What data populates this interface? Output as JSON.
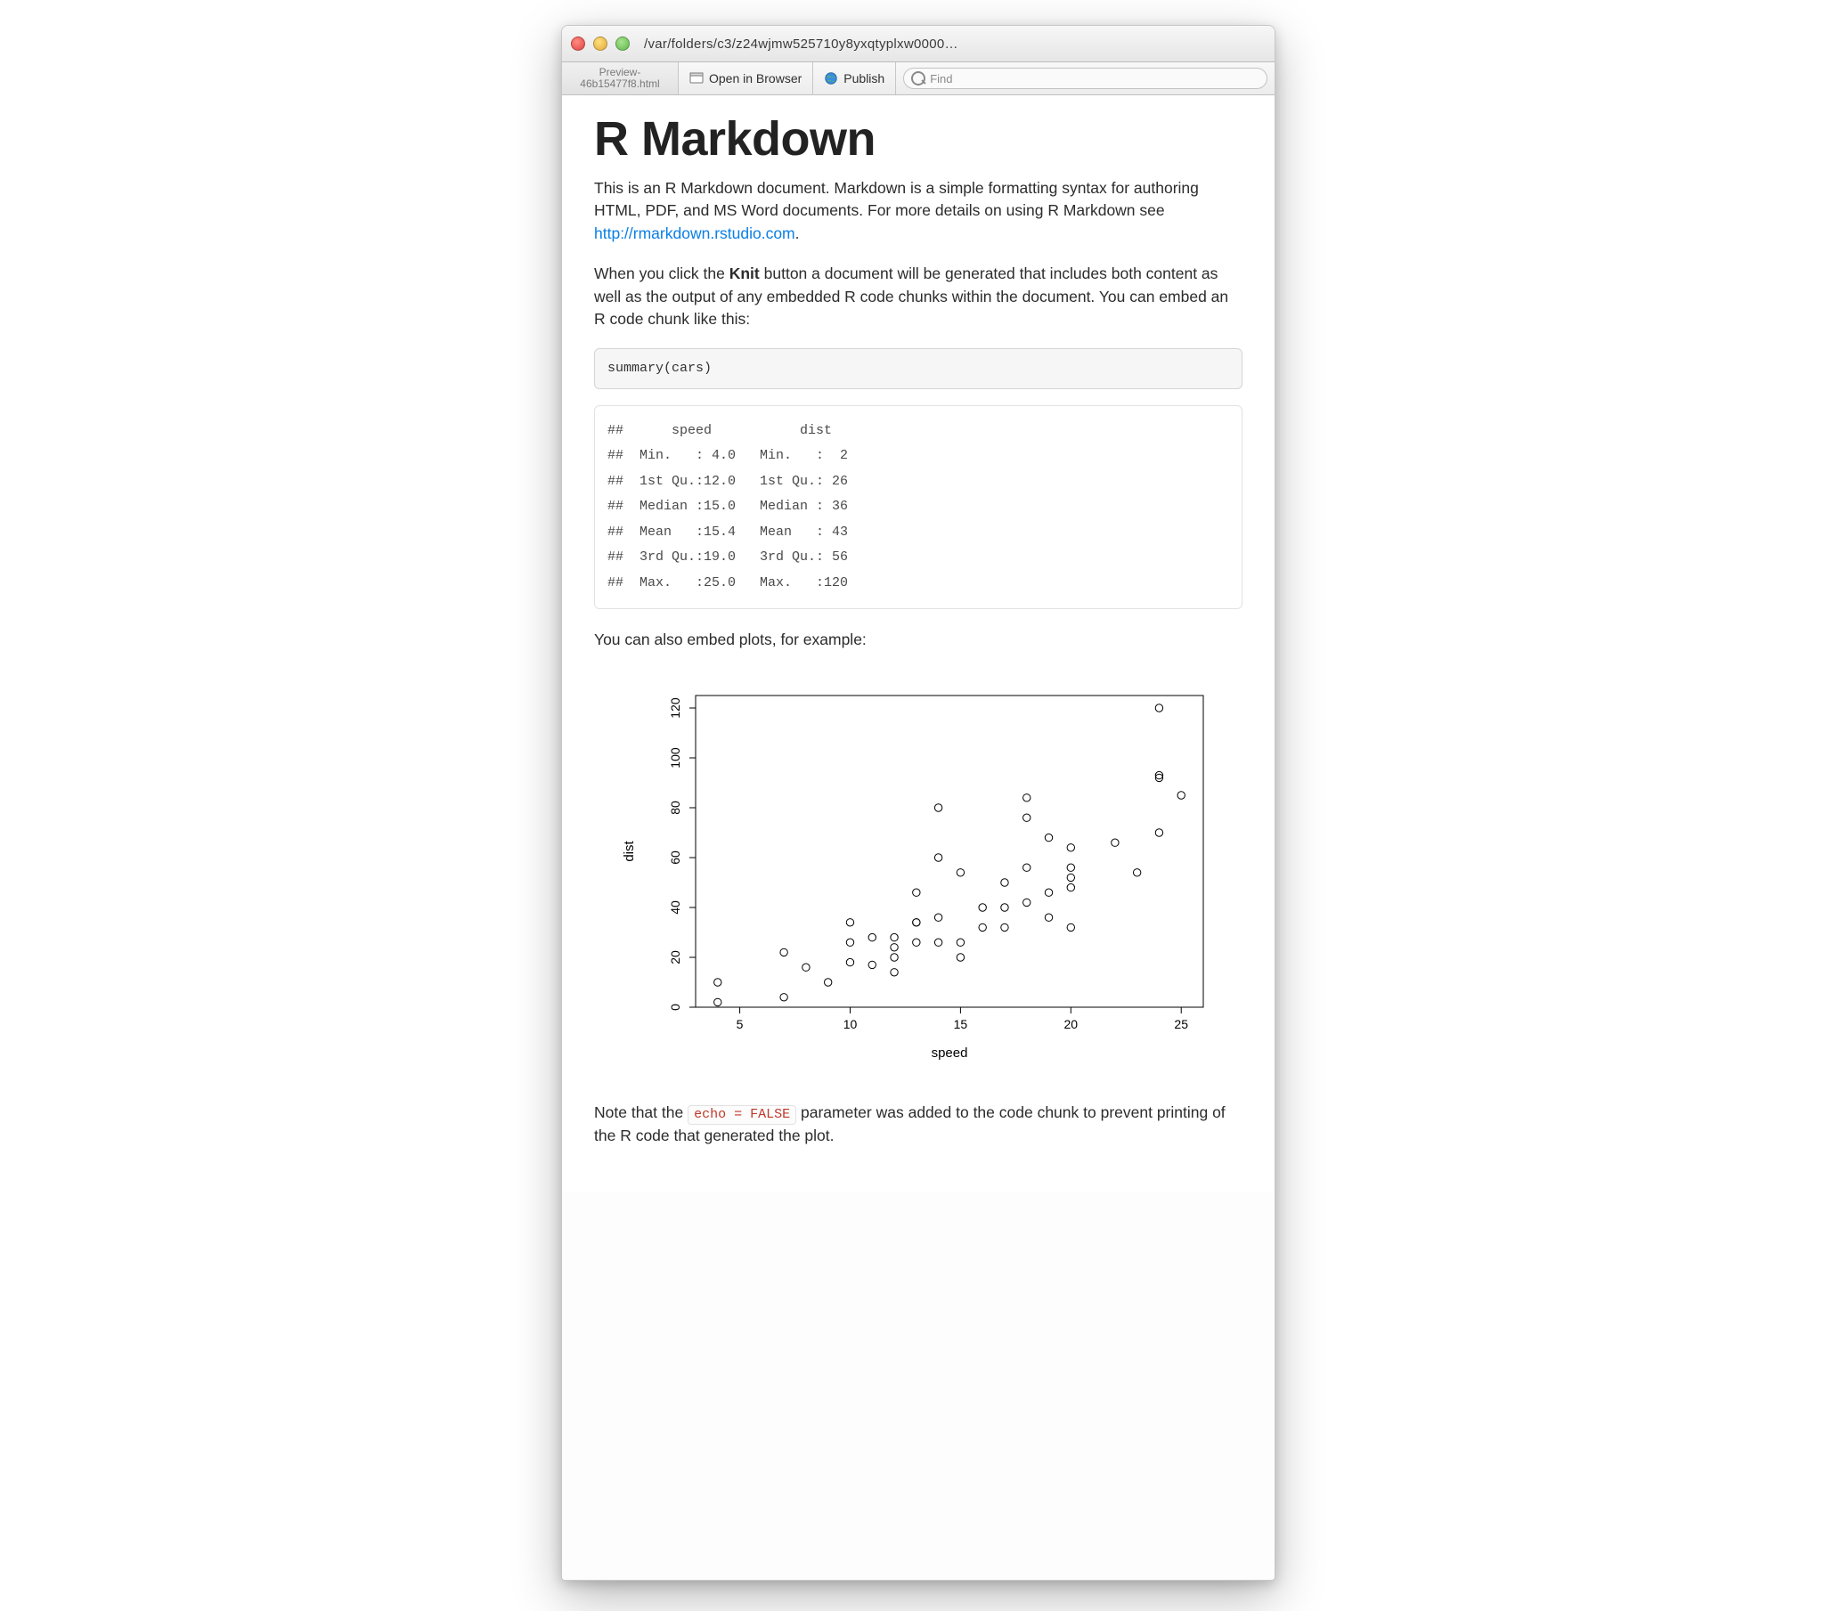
{
  "window": {
    "title_path": "/var/folders/c3/z24wjmw525710y8yxqtyplxw0000…"
  },
  "tab": {
    "line1": "Preview-",
    "line2": "46b15477f8.html"
  },
  "toolbar": {
    "open_in_browser": "Open in Browser",
    "publish": "Publish",
    "find_placeholder": "Find"
  },
  "doc": {
    "heading": "R Markdown",
    "p1_a": "This is an R Markdown document. Markdown is a simple formatting syntax for authoring HTML, PDF, and MS Word documents. For more details on using R Markdown see ",
    "p1_link": "http://rmarkdown.rstudio.com",
    "p1_b": ".",
    "p2_a": "When you click the ",
    "p2_bold": "Knit",
    "p2_b": " button a document will be generated that includes both content as well as the output of any embedded R code chunks within the document. You can embed an R code chunk like this:",
    "code1": "summary(cars)",
    "output_lines": [
      "##      speed           dist    ",
      "##  Min.   : 4.0   Min.   :  2  ",
      "##  1st Qu.:12.0   1st Qu.: 26  ",
      "##  Median :15.0   Median : 36  ",
      "##  Mean   :15.4   Mean   : 43  ",
      "##  3rd Qu.:19.0   3rd Qu.: 56  ",
      "##  Max.   :25.0   Max.   :120  "
    ],
    "p3": "You can also embed plots, for example:",
    "p4_a": "Note that the ",
    "p4_code": "echo = FALSE",
    "p4_b": " parameter was added to the code chunk to prevent printing of the R code that generated the plot."
  },
  "chart_data": {
    "type": "scatter",
    "title": "",
    "xlabel": "speed",
    "ylabel": "dist",
    "xlim": [
      3,
      26
    ],
    "ylim": [
      0,
      125
    ],
    "x_ticks": [
      5,
      10,
      15,
      20,
      25
    ],
    "y_ticks": [
      0,
      20,
      40,
      60,
      80,
      100,
      120
    ],
    "series": [
      {
        "name": "cars",
        "points": [
          {
            "x": 4,
            "y": 2
          },
          {
            "x": 4,
            "y": 10
          },
          {
            "x": 7,
            "y": 4
          },
          {
            "x": 7,
            "y": 22
          },
          {
            "x": 8,
            "y": 16
          },
          {
            "x": 9,
            "y": 10
          },
          {
            "x": 10,
            "y": 18
          },
          {
            "x": 10,
            "y": 26
          },
          {
            "x": 10,
            "y": 34
          },
          {
            "x": 11,
            "y": 17
          },
          {
            "x": 11,
            "y": 28
          },
          {
            "x": 12,
            "y": 14
          },
          {
            "x": 12,
            "y": 20
          },
          {
            "x": 12,
            "y": 24
          },
          {
            "x": 12,
            "y": 28
          },
          {
            "x": 13,
            "y": 26
          },
          {
            "x": 13,
            "y": 34
          },
          {
            "x": 13,
            "y": 34
          },
          {
            "x": 13,
            "y": 46
          },
          {
            "x": 14,
            "y": 26
          },
          {
            "x": 14,
            "y": 36
          },
          {
            "x": 14,
            "y": 60
          },
          {
            "x": 14,
            "y": 80
          },
          {
            "x": 15,
            "y": 20
          },
          {
            "x": 15,
            "y": 26
          },
          {
            "x": 15,
            "y": 54
          },
          {
            "x": 16,
            "y": 32
          },
          {
            "x": 16,
            "y": 40
          },
          {
            "x": 17,
            "y": 32
          },
          {
            "x": 17,
            "y": 40
          },
          {
            "x": 17,
            "y": 50
          },
          {
            "x": 18,
            "y": 42
          },
          {
            "x": 18,
            "y": 56
          },
          {
            "x": 18,
            "y": 76
          },
          {
            "x": 18,
            "y": 84
          },
          {
            "x": 19,
            "y": 36
          },
          {
            "x": 19,
            "y": 46
          },
          {
            "x": 19,
            "y": 68
          },
          {
            "x": 20,
            "y": 32
          },
          {
            "x": 20,
            "y": 48
          },
          {
            "x": 20,
            "y": 52
          },
          {
            "x": 20,
            "y": 56
          },
          {
            "x": 20,
            "y": 64
          },
          {
            "x": 22,
            "y": 66
          },
          {
            "x": 23,
            "y": 54
          },
          {
            "x": 24,
            "y": 70
          },
          {
            "x": 24,
            "y": 92
          },
          {
            "x": 24,
            "y": 93
          },
          {
            "x": 24,
            "y": 120
          },
          {
            "x": 25,
            "y": 85
          }
        ]
      }
    ]
  }
}
